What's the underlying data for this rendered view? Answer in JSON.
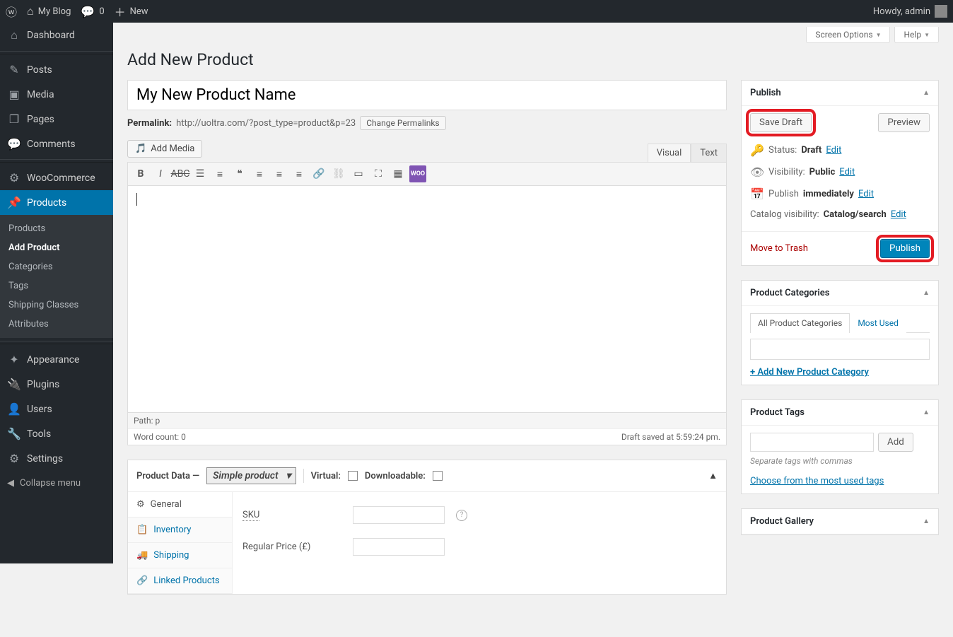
{
  "adminbar": {
    "site_name": "My Blog",
    "comments_count": "0",
    "new_label": "New",
    "howdy": "Howdy, admin"
  },
  "sidebar": {
    "items": [
      {
        "icon": "⌂",
        "label": "Dashboard"
      },
      {
        "sep": true
      },
      {
        "icon": "✎",
        "label": "Posts"
      },
      {
        "icon": "▣",
        "label": "Media"
      },
      {
        "icon": "❐",
        "label": "Pages"
      },
      {
        "icon": "💬",
        "label": "Comments"
      },
      {
        "sep": true
      },
      {
        "icon": "⚙",
        "label": "WooCommerce"
      },
      {
        "icon": "📌",
        "label": "Products",
        "current": true
      },
      {
        "sep": true
      },
      {
        "icon": "✦",
        "label": "Appearance"
      },
      {
        "icon": "🔌",
        "label": "Plugins"
      },
      {
        "icon": "👤",
        "label": "Users"
      },
      {
        "icon": "🔧",
        "label": "Tools"
      },
      {
        "icon": "⚙",
        "label": "Settings"
      }
    ],
    "submenu": [
      "Products",
      "Add Product",
      "Categories",
      "Tags",
      "Shipping Classes",
      "Attributes"
    ],
    "submenu_current": "Add Product",
    "collapse": "Collapse menu"
  },
  "screen_tabs": {
    "screen_options": "Screen Options",
    "help": "Help"
  },
  "page_title": "Add New Product",
  "title_value": "My New Product Name",
  "permalink": {
    "label": "Permalink:",
    "url": "http://uoltra.com/?post_type=product&p=23",
    "change": "Change Permalinks"
  },
  "editor": {
    "add_media": "Add Media",
    "tabs": {
      "visual": "Visual",
      "text": "Text"
    },
    "path_label": "Path:",
    "path_value": "p",
    "wordcount": "Word count: 0",
    "saved_at": "Draft saved at 5:59:24 pm."
  },
  "publish": {
    "title": "Publish",
    "save_draft": "Save Draft",
    "preview": "Preview",
    "status_label": "Status:",
    "status_value": "Draft",
    "edit": "Edit",
    "visibility_label": "Visibility:",
    "visibility_value": "Public",
    "publish_label": "Publish",
    "publish_value": "immediately",
    "catalog_label": "Catalog visibility:",
    "catalog_value": "Catalog/search",
    "trash": "Move to Trash",
    "publish_btn": "Publish"
  },
  "categories": {
    "title": "Product Categories",
    "tab_all": "All Product Categories",
    "tab_most": "Most Used",
    "add_new": "+ Add New Product Category"
  },
  "tags": {
    "title": "Product Tags",
    "add": "Add",
    "hint": "Separate tags with commas",
    "choose": "Choose from the most used tags"
  },
  "gallery": {
    "title": "Product Gallery"
  },
  "product_data": {
    "title": "Product Data —",
    "type": "Simple product",
    "virtual": "Virtual:",
    "downloadable": "Downloadable:",
    "tabs": [
      "General",
      "Inventory",
      "Shipping",
      "Linked Products"
    ],
    "sku_label": "SKU",
    "price_label": "Regular Price (£)"
  }
}
